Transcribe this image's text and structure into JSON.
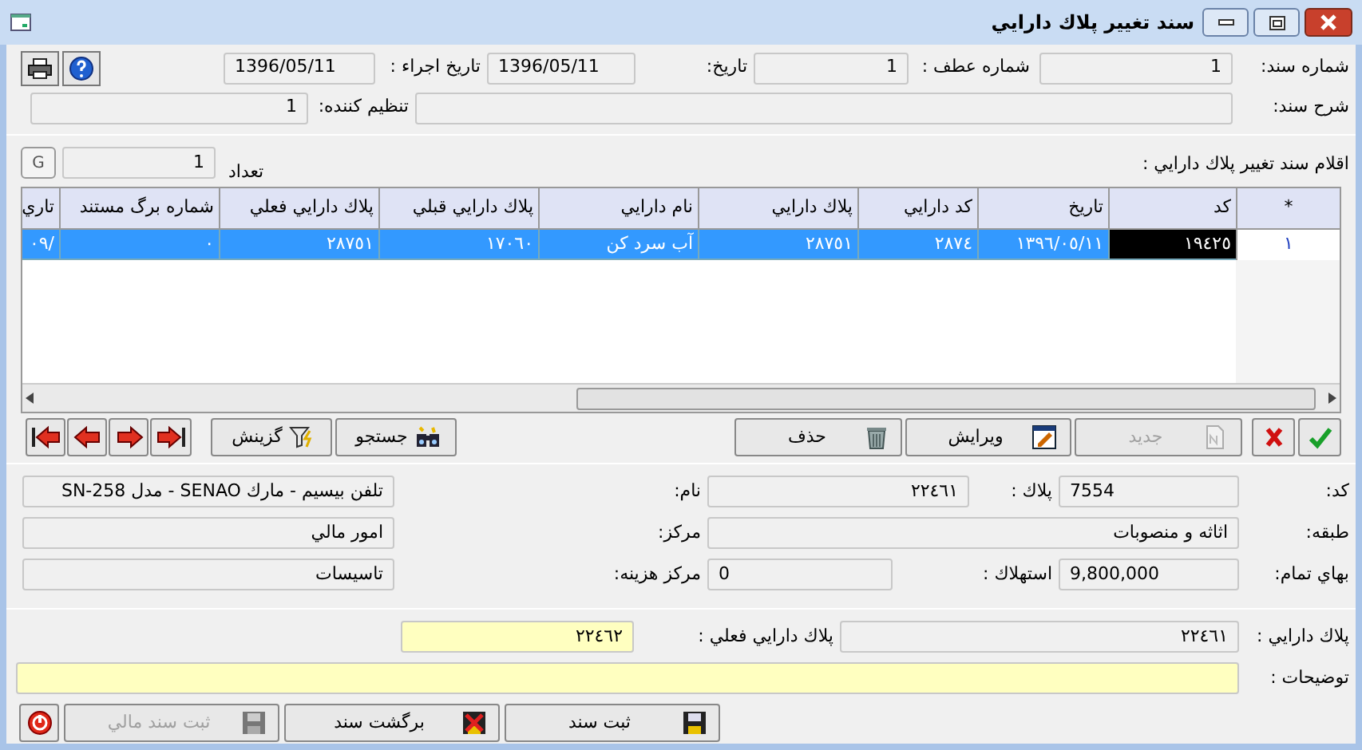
{
  "window": {
    "title": "سند تغيير پلاك دارايي"
  },
  "header_rows": [
    [
      {
        "label": "شماره سند:",
        "value": "1"
      },
      {
        "label": "شماره عطف :",
        "value": "1"
      },
      {
        "label": "تاريخ:",
        "value": "1396/05/11"
      },
      {
        "label": "تاريخ اجراء :",
        "value": "1396/05/11"
      }
    ],
    [
      {
        "label": "شرح سند:"
      },
      {
        "label": "تنظيم كننده:",
        "value": "1"
      }
    ]
  ],
  "items_section": {
    "title": "اقلام سند تغيير پلاك دارايي :",
    "count_label": "تعداد",
    "count": "1",
    "g_button": "G"
  },
  "table": {
    "corner": "*",
    "columns": [
      "كد",
      "تاريخ",
      "كد دارايي",
      "پلاك دارايي",
      "نام دارايي",
      "پلاك دارايي قبلي",
      "پلاك دارايي فعلي",
      "شماره برگ مستند",
      "تاري"
    ],
    "rows": [
      {
        "selected": true,
        "row_header": "١",
        "cells": [
          {
            "text": "١٩٤٢٥",
            "focused": true
          },
          {
            "text": "١٣٩٦/٠٥/١١",
            "focused": false
          },
          {
            "text": "٢٨٧٤",
            "focused": false
          },
          {
            "text": "٢٨٧٥١",
            "focused": false
          },
          {
            "text": "آب سرد كن",
            "focused": false
          },
          {
            "text": "١٧٠٦٠",
            "focused": false
          },
          {
            "text": "٢٨٧٥١",
            "focused": false
          },
          {
            "text": "٠",
            "focused": false
          },
          {
            "text": "/٠٩",
            "focused": false
          }
        ]
      }
    ]
  },
  "toolbar": [
    {
      "kind": "ok",
      "disabled": false
    },
    {
      "kind": "cancel",
      "disabled": false
    },
    {
      "kind": "new",
      "label": "جديد",
      "disabled": true
    },
    {
      "kind": "edit",
      "label": "ويرايش",
      "disabled": false
    },
    {
      "kind": "delete",
      "label": "حذف",
      "disabled": false
    },
    {
      "kind": "search",
      "label": "جستجو",
      "disabled": false
    },
    {
      "kind": "filter",
      "label": "گزينش",
      "disabled": false
    },
    {
      "kind": "last",
      "disabled": false
    },
    {
      "kind": "next",
      "disabled": false
    },
    {
      "kind": "prev",
      "disabled": false
    },
    {
      "kind": "first",
      "disabled": false
    }
  ],
  "detail_rows": [
    [
      {
        "label": "كد:",
        "value": "7554"
      },
      {
        "label": "پلاك :",
        "value": "٢٢٤٦١"
      },
      {
        "label": "نام:",
        "value": "تلفن بيسيم - مارك SENAO - مدل SN-258"
      }
    ],
    [
      {
        "label": "طبقه:",
        "value": "اثاثه و منصوبات"
      },
      {
        "label": "مركز:",
        "value": "امور مالي"
      }
    ],
    [
      {
        "label": "بهاي تمام:",
        "value": "9,800,000"
      },
      {
        "label": "استهلاك :",
        "value": "0"
      },
      {
        "label": "مركز هزينه:",
        "value": "تاسيسات"
      }
    ]
  ],
  "bottom_rows": [
    [
      {
        "label": "پلاك دارايي :",
        "value": "٢٢٤٦١",
        "editable": false
      },
      {
        "label": "پلاك دارايي فعلي :",
        "value": "٢٢٤٦٢",
        "editable": true
      }
    ],
    [
      {
        "label": "توضيحات :",
        "editable": true
      }
    ]
  ],
  "bottom_buttons": [
    {
      "kind": "save",
      "label": "ثبت سند",
      "disabled": false
    },
    {
      "kind": "revert",
      "label": "برگشت سند",
      "disabled": false
    },
    {
      "kind": "save",
      "label": "ثبت سند مالي",
      "disabled": true
    },
    {
      "kind": "exit",
      "disabled": false
    }
  ]
}
